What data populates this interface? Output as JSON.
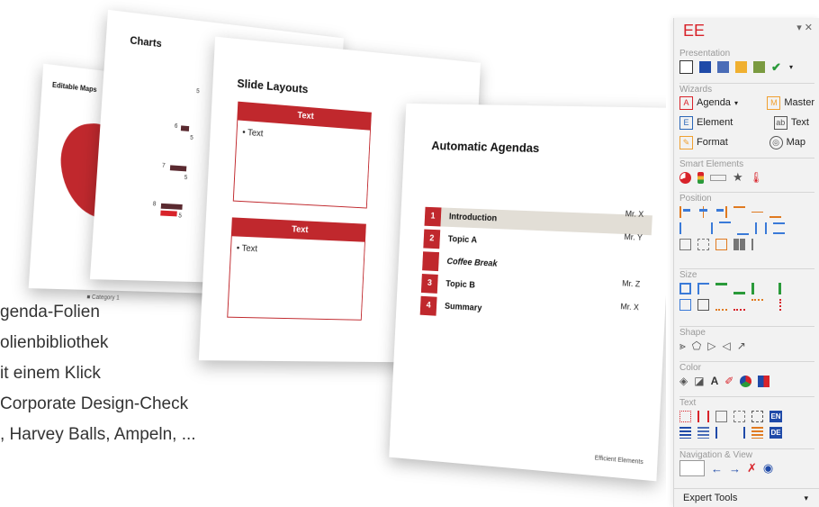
{
  "slides": {
    "maps": {
      "title": "Editable Maps",
      "legend": "■ Category 1"
    },
    "charts": {
      "title": "Charts",
      "numbers": [
        "5",
        "6",
        "5",
        "7",
        "5",
        "8",
        "5"
      ]
    },
    "layouts": {
      "title": "Slide Layouts",
      "boxes": [
        {
          "head": "Text",
          "bullet": "• Text"
        },
        {
          "head": "Text",
          "bullet": "• Text"
        }
      ]
    },
    "agenda": {
      "title": "Automatic Agendas",
      "rows": [
        {
          "num": "1",
          "label": "Introduction",
          "owner": "Mr. X",
          "active": true
        },
        {
          "num": "2",
          "label": "Topic A",
          "owner": "Mr. Y"
        },
        {
          "num": "",
          "label": "Coffee Break",
          "owner": ""
        },
        {
          "num": "3",
          "label": "Topic B",
          "owner": "Mr. Z"
        },
        {
          "num": "4",
          "label": "Summary",
          "owner": "Mr. X"
        }
      ],
      "footer": "Efficient Elements"
    }
  },
  "bullets": [
    "genda-Folien",
    "olienbibliothek",
    "it einem Klick",
    "Corporate Design-Check",
    ", Harvey Balls, Ampeln, ..."
  ],
  "panel": {
    "title": "EE",
    "controls": "▾ ✕",
    "sections": {
      "presentation": "Presentation",
      "wizards": "Wizards",
      "smart": "Smart Elements",
      "position": "Position",
      "size": "Size",
      "shape": "Shape",
      "color": "Color",
      "text": "Text",
      "nav": "Navigation & View"
    },
    "wizards": {
      "agenda": "Agenda",
      "master": "Master",
      "element": "Element",
      "text": "Text",
      "format": "Format",
      "map": "Map"
    },
    "text_badges": {
      "en": "EN",
      "de": "DE"
    },
    "expert_tools": "Expert Tools"
  },
  "colors": {
    "brand_red": "#c0282d",
    "accent_blue": "#1f4aa8"
  }
}
